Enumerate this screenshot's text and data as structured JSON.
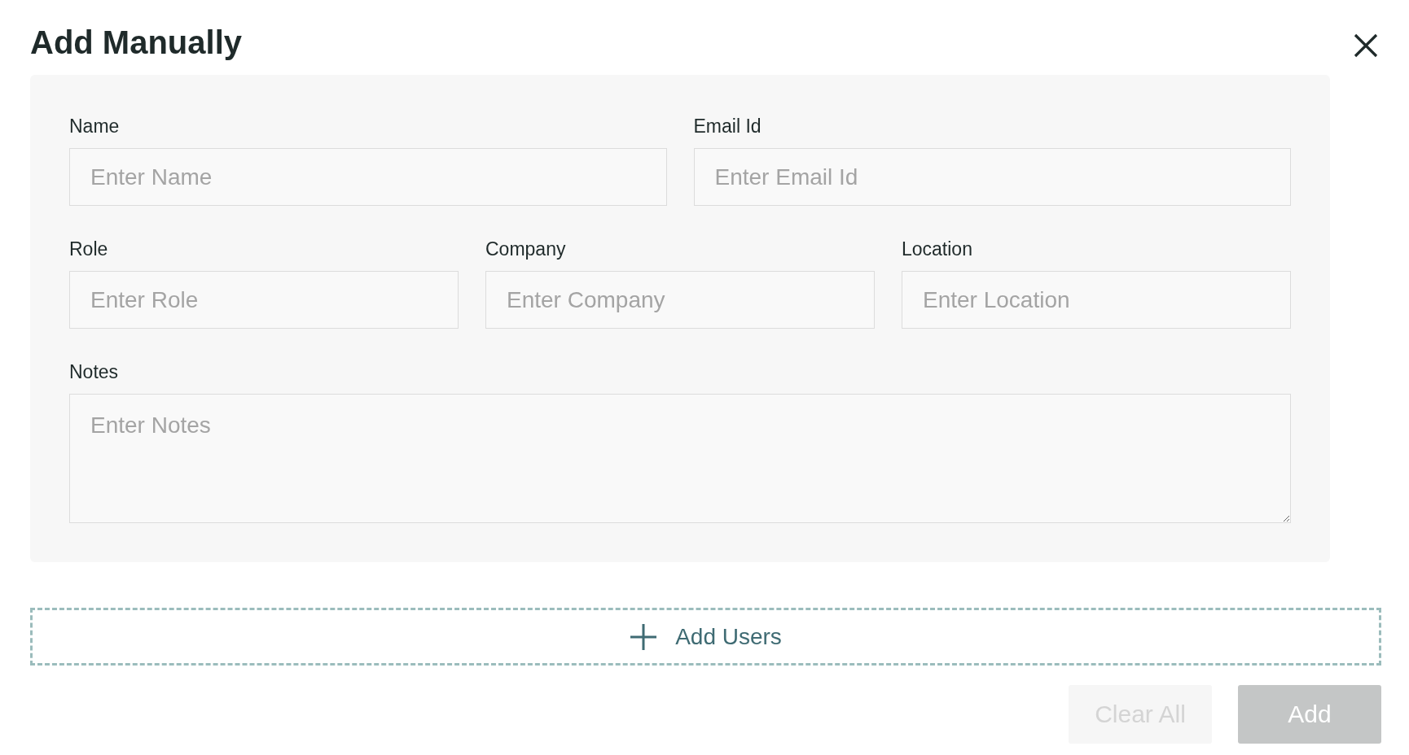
{
  "dialog": {
    "title": "Add Manually"
  },
  "fields": [
    {
      "label": "Name",
      "placeholder": "Enter Name",
      "kind": "input"
    },
    {
      "label": "Email Id",
      "placeholder": "Enter Email Id",
      "kind": "input"
    },
    {
      "label": "Role",
      "placeholder": "Enter Role",
      "kind": "input"
    },
    {
      "label": "Company",
      "placeholder": "Enter Company",
      "kind": "input"
    },
    {
      "label": "Location",
      "placeholder": "Enter Location",
      "kind": "input"
    },
    {
      "label": "Notes",
      "placeholder": "Enter Notes",
      "kind": "textarea"
    }
  ],
  "add_users": {
    "label": "Add Users"
  },
  "buttons": [
    {
      "label": "Clear All",
      "kind": "secondary",
      "disabled": true
    },
    {
      "label": "Add",
      "kind": "primary",
      "disabled": true
    }
  ]
}
